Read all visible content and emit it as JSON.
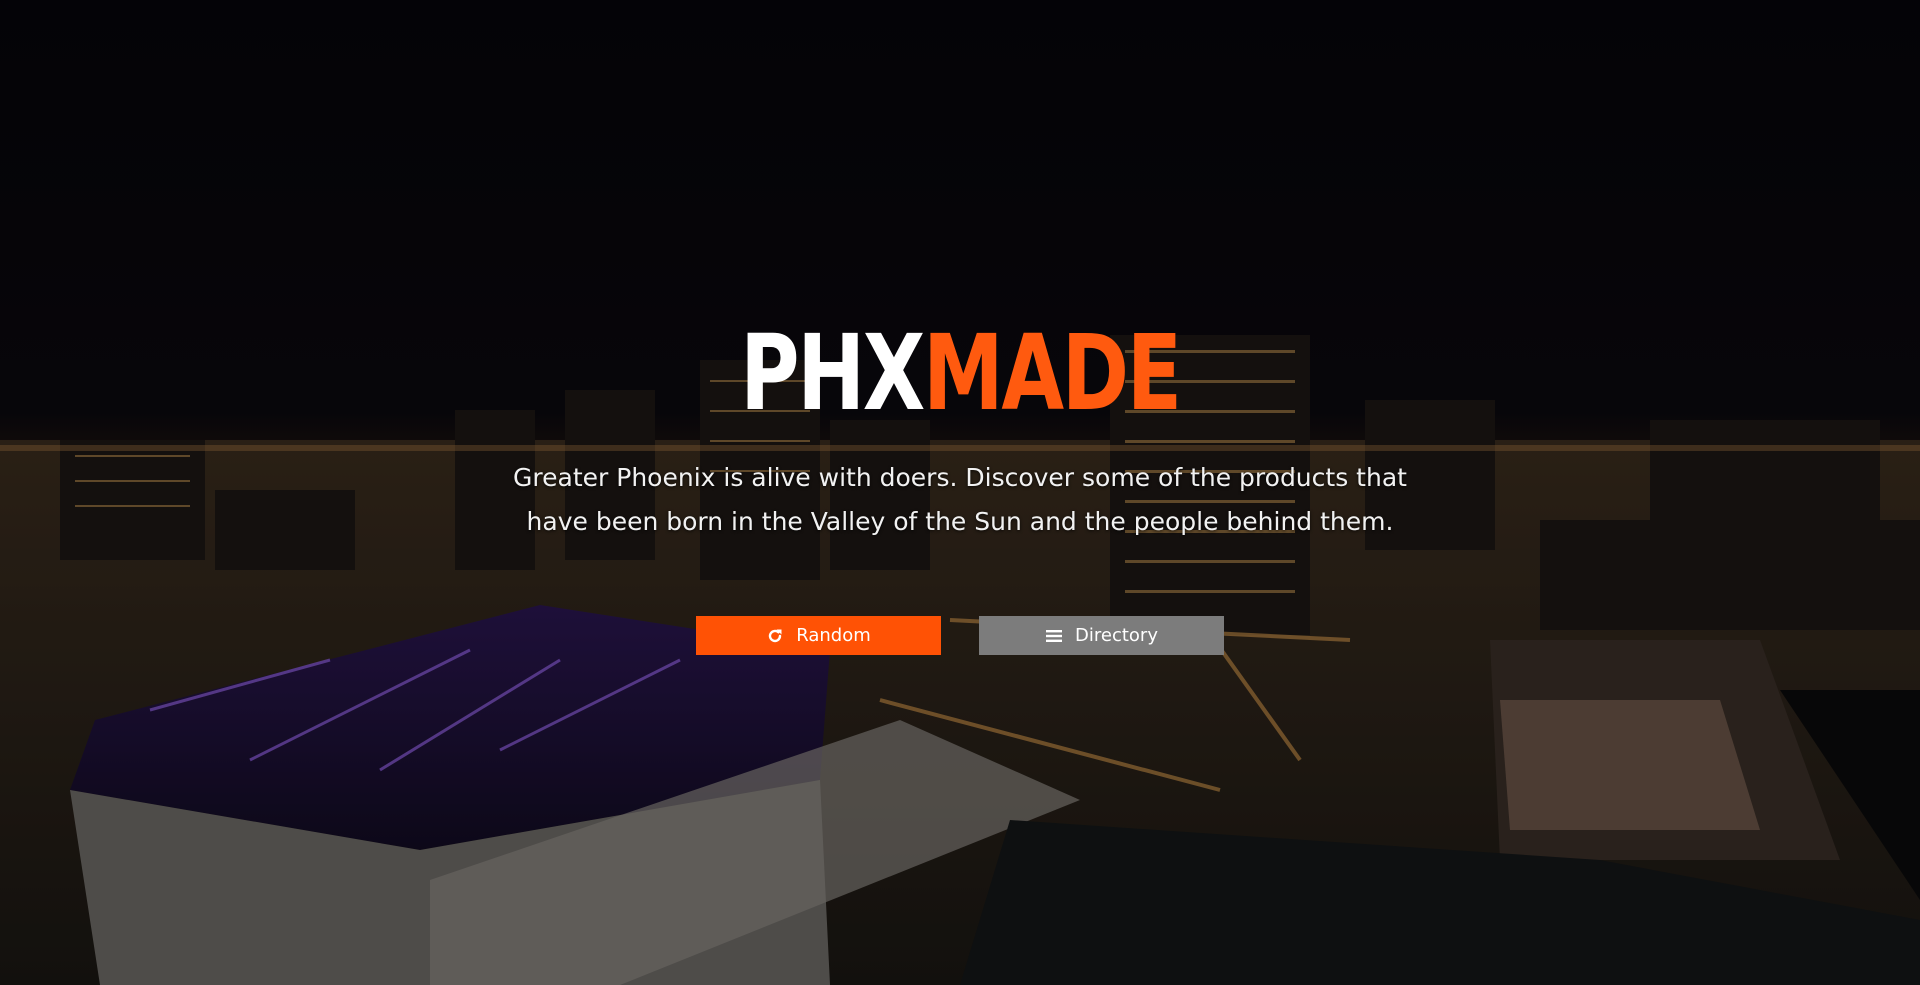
{
  "brand": {
    "part1": "PHX",
    "part2": "MADE",
    "color_part1": "#ffffff",
    "color_part2": "#ff5a0f"
  },
  "hero": {
    "tagline_line1": "Greater Phoenix is alive with doers. Discover some of the products that",
    "tagline_line2": "have been born in the Valley of the Sun and the people behind them.",
    "background": "night-city-skyline-photo"
  },
  "actions": {
    "random": {
      "label": "Random",
      "icon": "refresh-icon",
      "color": "#ff5205"
    },
    "directory": {
      "label": "Directory",
      "icon": "list-icon",
      "color": "#7c7c7c"
    }
  }
}
